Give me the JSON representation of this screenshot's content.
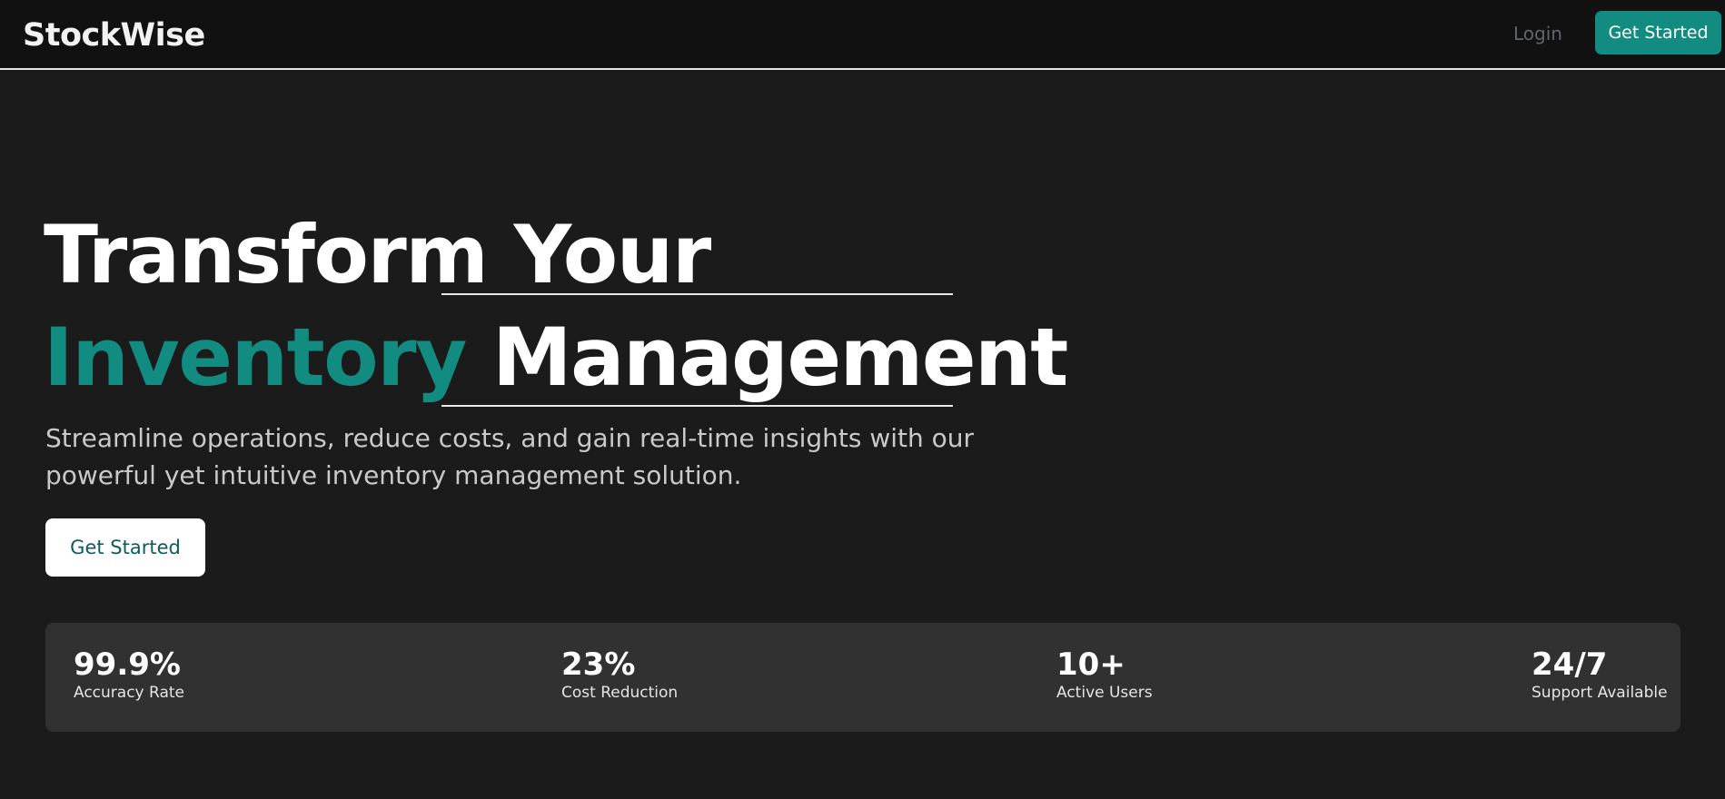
{
  "nav": {
    "brand": "StockWise",
    "login": "Login",
    "cta": "Get Started"
  },
  "hero": {
    "line1_left": "Transform",
    "line1_right": "Your",
    "line2_accent": "Inventory",
    "line2_right": "Management",
    "subtitle": "Streamline operations, reduce costs, and gain real-time insights with our powerful yet intuitive inventory management solution.",
    "cta": "Get Started"
  },
  "stats": [
    {
      "value": "99.9%",
      "label": "Accuracy Rate"
    },
    {
      "value": "23%",
      "label": "Cost Reduction"
    },
    {
      "value": "10+",
      "label": "Active Users"
    },
    {
      "value": "24/7",
      "label": "Support Available"
    }
  ],
  "colors": {
    "background": "#1b1b1b",
    "navbar": "#111111",
    "accent": "#128b80",
    "stats_panel": "#313131"
  }
}
